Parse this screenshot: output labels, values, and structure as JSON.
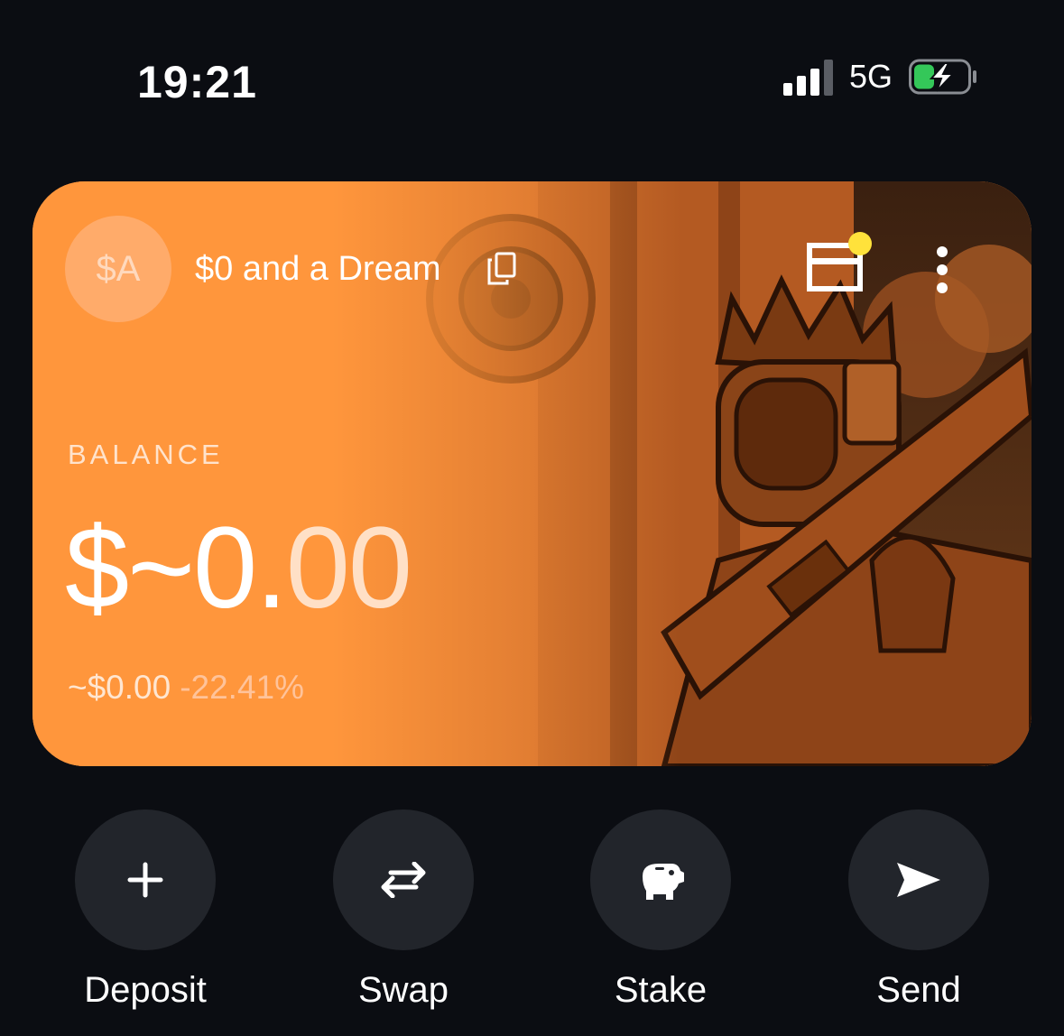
{
  "status_bar": {
    "time": "19:21",
    "network": "5G",
    "battery_charging": true,
    "battery_level": 0.35
  },
  "wallet": {
    "avatar_initials": "$A",
    "name": "$0 and a Dream",
    "balance_label": "BALANCE",
    "balance_main": "$~0.",
    "balance_cents": "00",
    "balance_usd": "~$0.00",
    "balance_change": "-22.41%",
    "accent_color": "#ff963c",
    "notification_dot_color": "#ffe23b"
  },
  "actions": [
    {
      "label": "Deposit",
      "icon": "plus-icon"
    },
    {
      "label": "Swap",
      "icon": "swap-arrows-icon"
    },
    {
      "label": "Stake",
      "icon": "piggy-bank-icon"
    },
    {
      "label": "Send",
      "icon": "send-icon"
    }
  ]
}
